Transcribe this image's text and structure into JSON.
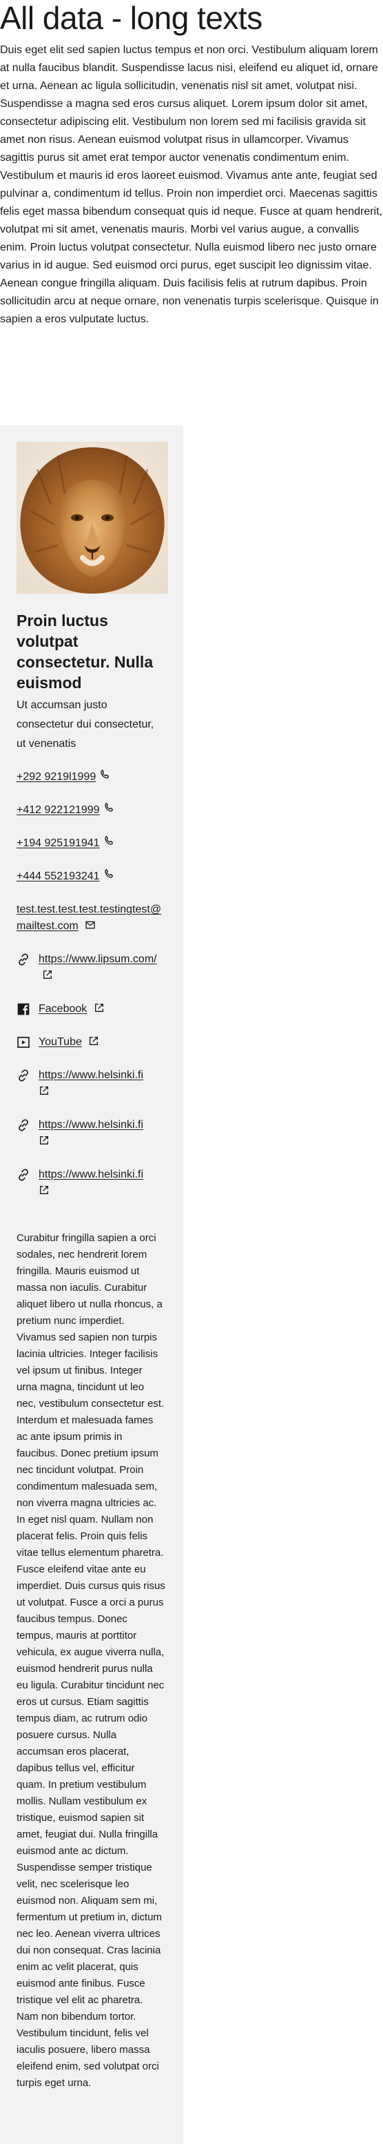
{
  "page": {
    "title": "All data - long texts",
    "intro": "Duis eget elit sed sapien luctus tempus et non orci. Vestibulum aliquam lorem at nulla faucibus blandit. Suspendisse lacus nisi, eleifend eu aliquet id, ornare et urna. Aenean ac ligula sollicitudin, venenatis nisl sit amet, volutpat nisi. Suspendisse a magna sed eros cursus aliquet. Lorem ipsum dolor sit amet, consectetur adipiscing elit. Vestibulum non lorem sed mi facilisis gravida sit amet non risus. Aenean euismod volutpat risus in ullamcorper. Vivamus sagittis purus sit amet erat tempor auctor venenatis condimentum enim. Vestibulum et mauris id eros laoreet euismod. Vivamus ante ante, feugiat sed pulvinar a, condimentum id tellus. Proin non imperdiet orci. Maecenas sagittis felis eget massa bibendum consequat quis id neque. Fusce at quam hendrerit, volutpat mi sit amet, venenatis mauris. Morbi vel varius augue, a convallis enim. Proin luctus volutpat consectetur. Nulla euismod libero nec justo ornare varius in id augue. Sed euismod orci purus, eget suscipit leo dignissim vitae. Aenean congue fringilla aliquam. Duis facilisis felis at rutrum dapibus. Proin sollicitudin arcu at neque ornare, non venenatis turpis scelerisque. Quisque in sapien a eros vulputate luctus."
  },
  "card": {
    "title": "Proin luctus volutpat consectetur. Nulla euismod",
    "subtitle": "Ut accumsan justo consectetur dui consectetur, ut venenatis",
    "phones": [
      "+292 9219l1999",
      "+412 922121999",
      "+194 925191941",
      "+444 552193241"
    ],
    "email": "test.test.test.test.testingtest@mailtest.com",
    "links": [
      {
        "label": "https://www.lipsum.com/",
        "icon": "link-icon"
      },
      {
        "label": "Facebook",
        "icon": "facebook-icon"
      },
      {
        "label": "YouTube",
        "icon": "youtube-icon"
      },
      {
        "label": "https://www.helsinki.fi",
        "icon": "link-icon"
      },
      {
        "label": "https://www.helsinki.fi",
        "icon": "link-icon"
      },
      {
        "label": "https://www.helsinki.fi",
        "icon": "link-icon"
      }
    ],
    "body": "Curabitur fringilla sapien a orci sodales, nec hendrerit lorem fringilla. Mauris euismod ut massa non iaculis. Curabitur aliquet libero ut nulla rhoncus, a pretium nunc imperdiet. Vivamus sed sapien non turpis lacinia ultricies. Integer facilisis vel ipsum ut finibus. Integer urna magna, tincidunt ut leo nec, vestibulum consectetur est. Interdum et malesuada fames ac ante ipsum primis in faucibus. Donec pretium ipsum nec tincidunt volutpat. Proin condimentum malesuada sem, non viverra magna ultricies ac. In eget nisl quam. Nullam non placerat felis. Proin quis felis vitae tellus elementum pharetra. Fusce eleifend vitae ante eu imperdiet. Duis cursus quis risus ut volutpat. Fusce a orci a purus faucibus tempus. Donec tempus, mauris at porttitor vehicula, ex augue viverra nulla, euismod hendrerit purus nulla eu ligula. Curabitur tincidunt nec eros ut cursus. Etiam sagittis tempus diam, ac rutrum odio posuere cursus. Nulla accumsan eros placerat, dapibus tellus vel, efficitur quam. In pretium vestibulum mollis. Nullam vestibulum ex tristique, euismod sapien sit amet, feugiat dui. Nulla fringilla euismod ante ac dictum. Suspendisse semper tristique velit, nec scelerisque leo euismod non. Aliquam sem mi, fermentum ut pretium in, dictum nec leo. Aenean viverra ultrices dui non consequat. Cras lacinia enim ac velit placerat, quis euismod ante finibus. Fusce tristique vel elit ac pharetra. Nam non bibendum tortor. Vestibulum tincidunt, felis vel iaculis posuere, libero massa eleifend enim, sed volutpat orci turpis eget urna."
  },
  "colors": {
    "card_bg": "#f2f2f2",
    "text": "#1a1a1a"
  }
}
